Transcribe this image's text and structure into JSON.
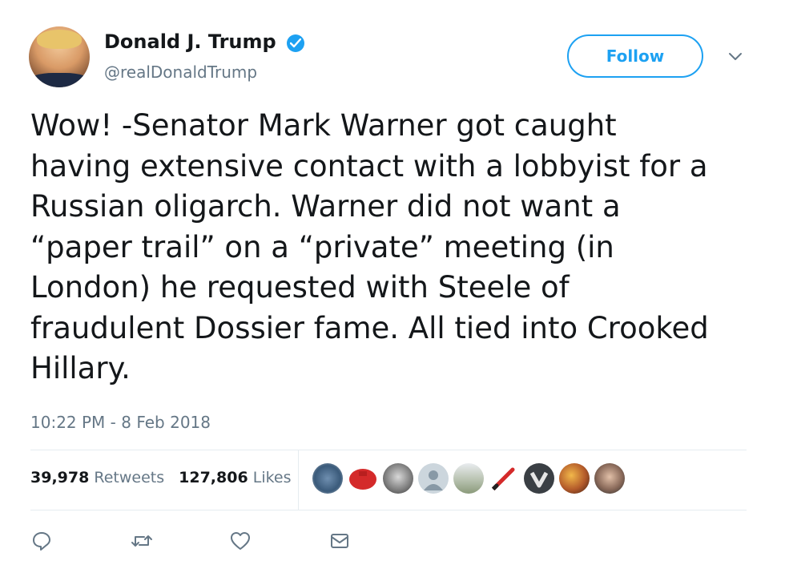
{
  "tweet": {
    "author_name": "Donald J. Trump",
    "handle": "@realDonaldTrump",
    "follow_label": "Follow",
    "text": "Wow! -Senator Mark Warner got caught\nhaving extensive contact with a lobbyist for a\nRussian oligarch. Warner did not want a\n“paper trail” on a “private” meeting (in\nLondon) he requested with Steele of\nfraudulent Dossier fame. All tied into Crooked\nHillary.",
    "timestamp": "10:22 PM - 8 Feb 2018",
    "retweets_count": "39,978",
    "retweets_label": "Retweets",
    "likes_count": "127,806",
    "likes_label": "Likes"
  },
  "icons": {
    "verified": "verified-badge-icon",
    "caret": "chevron-down-icon",
    "reply": "reply-icon",
    "retweet": "retweet-icon",
    "like": "heart-icon",
    "message": "direct-message-icon"
  },
  "colors": {
    "accent": "#1da1f2",
    "text": "#14171a",
    "muted": "#657786",
    "divider": "#e6ecf0"
  }
}
